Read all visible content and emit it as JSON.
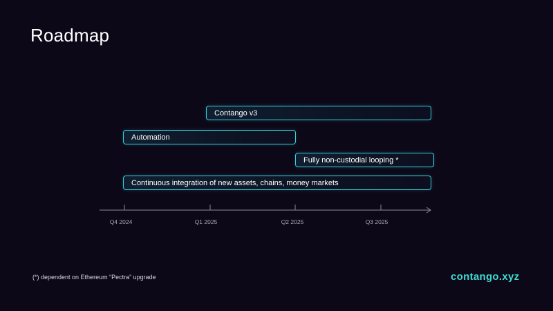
{
  "title": "Roadmap",
  "timeline": {
    "ticks": [
      "Q4 2024",
      "Q1 2025",
      "Q2 2025",
      "Q3 2025"
    ]
  },
  "items": [
    {
      "label": "Contango v3",
      "start": "Q1 2025",
      "end": "end"
    },
    {
      "label": "Automation",
      "start": "Q4 2024",
      "end": "Q2 2025"
    },
    {
      "label": "Fully non-custodial looping *",
      "start": "Q2 2025",
      "end": "end"
    },
    {
      "label": "Continuous integration of new assets, chains, money markets",
      "start": "Q4 2024",
      "end": "end"
    }
  ],
  "footnote": "(*) dependent on Ethereum “Pectra” upgrade",
  "logo": "contango.xyz",
  "colors": {
    "background": "#0d0818",
    "accent": "#36d3dc",
    "logo": "#3fd9cf"
  }
}
